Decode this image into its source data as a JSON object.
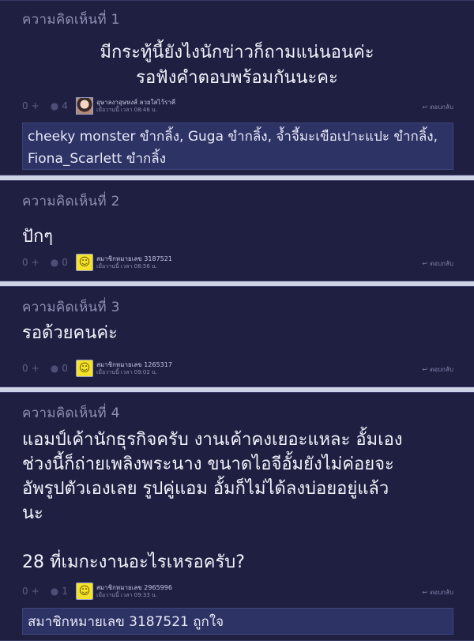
{
  "comments": [
    {
      "title": "ความคิดเห็นที่ 1",
      "body": [
        "มีกระทู้นี้ยังไงนักข่าวก็ถามแน่นอนค่ะ",
        "รอฟังคำตอบพร้อมกันนะคะ"
      ],
      "score": "0",
      "plus": "+",
      "reply_count": "4",
      "user": "อุษาลงาอุษหงส์ ลวยใสไว้ราคี",
      "time": "เมื่อวานนี้ เวลา 08:46 น.",
      "reply_label": "ตอบกลับ",
      "likes": "cheeky monster ขำกลิ้ง, Guga ขำกลิ้ง, จ้ำจี้มะเขือเปาะแปะ ขำกลิ้ง, Fiona_Scarlett ขำกลิ้ง"
    },
    {
      "title": "ความคิดเห็นที่ 2",
      "body": [
        "ปักๆ"
      ],
      "score": "0",
      "plus": "+",
      "reply_count": "0",
      "user": "สมาชิกหมายเลข 3187521",
      "time": "เมื่อวานนี้ เวลา 08:56 น.",
      "reply_label": "ตอบกลับ"
    },
    {
      "title": "ความคิดเห็นที่ 3",
      "body": [
        "รอด้วยคนค่ะ"
      ],
      "score": "0",
      "plus": "+",
      "reply_count": "0",
      "user": "สมาชิกหมายเลข 1265317",
      "time": "เมื่อวานนี้ เวลา 09:02 น.",
      "reply_label": "ตอบกลับ"
    },
    {
      "title": "ความคิดเห็นที่ 4",
      "body": [
        "แอมป์เค้านักธุรกิจครับ งานเค้าคงเยอะแหละ อั้มเอง",
        "ช่วงนี้ก็ถ่ายเพลิงพระนาง ขนาดไอจีอั้มยังไม่ค่อยจะ",
        "อัพรูปตัวเองเลย รูปคู่แอม อั้มก็ไม่ได้ลงบ่อยอยู่แล้ว",
        "นะ",
        "28 ที่เมกะงานอะไรเหรอครับ?"
      ],
      "score": "0",
      "plus": "+",
      "reply_count": "1",
      "user": "สมาชิกหมายเลข 2965996",
      "time": "เมื่อวานนี้ เวลา 09:33 น.",
      "reply_label": "ตอบกลับ",
      "likes": "สมาชิกหมายเลข 3187521 ถูกใจ"
    }
  ],
  "icons": {
    "plus": "plus-icon",
    "comment": "comment-icon",
    "reply": "reply-icon",
    "avatar_default": "smiley-avatar"
  }
}
